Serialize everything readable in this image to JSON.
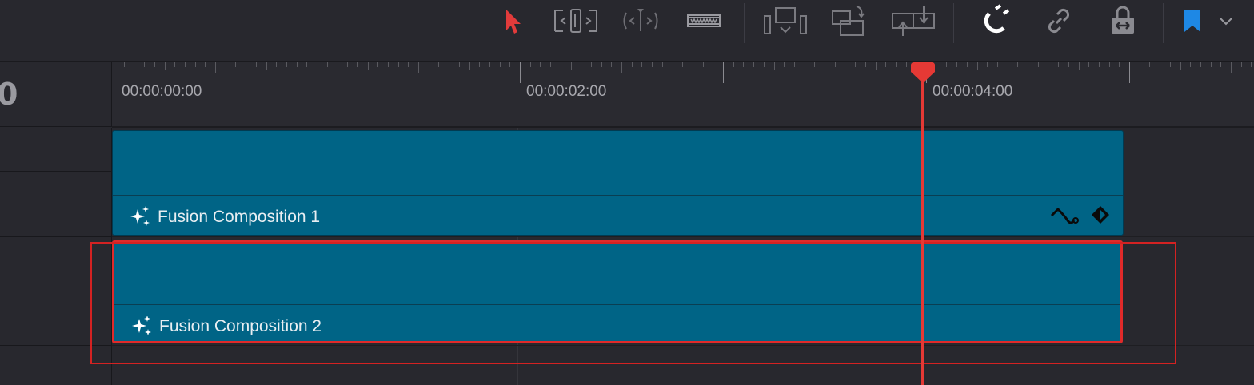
{
  "toolbar": {
    "tools": [
      {
        "name": "selection-mode",
        "icon": "arrow-pointer-icon",
        "active": true,
        "color": "#e23b3b"
      },
      {
        "name": "trim-edit-mode",
        "icon": "trim-edit-icon"
      },
      {
        "name": "dynamic-trim-mode",
        "icon": "dynamic-trim-icon"
      },
      {
        "name": "blade-edit-mode",
        "icon": "blade-icon"
      },
      {
        "name": "insert-clip",
        "icon": "insert-clip-icon"
      },
      {
        "name": "overwrite-clip",
        "icon": "overwrite-clip-icon"
      },
      {
        "name": "replace-clip",
        "icon": "replace-clip-icon"
      },
      {
        "name": "snapping",
        "icon": "magnet-icon",
        "active": true
      },
      {
        "name": "linked-selection",
        "icon": "link-icon"
      },
      {
        "name": "position-lock",
        "icon": "lock-icon"
      },
      {
        "name": "flag",
        "icon": "flag-icon",
        "color": "#1e88e5"
      },
      {
        "name": "flag-options",
        "icon": "chevron-down-icon"
      }
    ]
  },
  "timecode_fragment": "0",
  "ruler": {
    "labels": [
      "00:00:00:00",
      "00:00:02:00",
      "00:00:04:00"
    ]
  },
  "clips": [
    {
      "label": "Fusion Composition 1",
      "icon": "sparkle-icon",
      "selected": false,
      "badges": [
        "keyframe-curve-icon",
        "keyframe-diamond-icon"
      ]
    },
    {
      "label": "Fusion Composition 2",
      "icon": "sparkle-icon",
      "selected": true
    }
  ],
  "colors": {
    "clip": "#006486",
    "playhead": "#e53935",
    "selection": "#d42222",
    "background": "#28282e"
  }
}
